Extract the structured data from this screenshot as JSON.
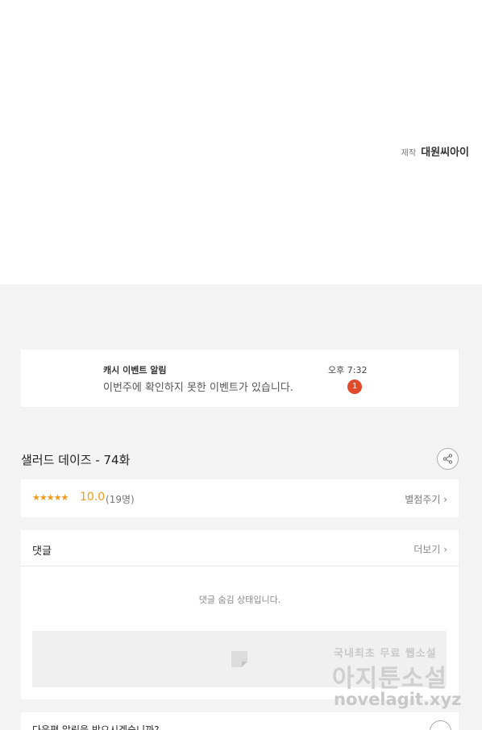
{
  "credit": {
    "label": "제작",
    "name": "대원씨아이"
  },
  "notification": {
    "title": "캐시 이벤트 알림",
    "message": "이번주에 확인하지 못한 이벤트가 있습니다.",
    "time": "오후 7:32",
    "badge_count": "1"
  },
  "episode": {
    "title": "샐러드 데이즈 - 74화"
  },
  "rating": {
    "stars": "★★★★★",
    "score": "10.0",
    "count": "(19명)",
    "rate_link": "별점주기 ›"
  },
  "comments": {
    "title": "댓글",
    "more_link": "더보기 ›",
    "hidden_message": "댓글 숨김 상태입니다."
  },
  "next_episode": {
    "prompt": "다음편 알림을 받으시겠습니까?"
  },
  "watermark": {
    "line1": "국내최초 무료 웹소설",
    "line2": "아지툰소설",
    "line3": "novelagit.xyz"
  },
  "colors": {
    "accent": "#f29a1a",
    "badge": "#e24a2b",
    "background": "#f3f3f3"
  }
}
